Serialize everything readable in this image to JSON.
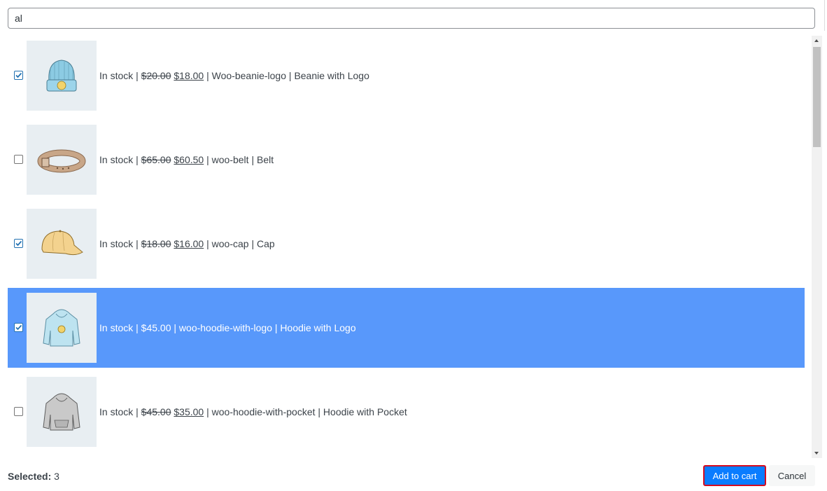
{
  "search": {
    "value": "al"
  },
  "products": [
    {
      "stock": "In stock",
      "regular_price": "$20.00",
      "sale_price": "$18.00",
      "price": "",
      "sku": "Woo-beanie-logo",
      "name": "Beanie with Logo",
      "checked": true,
      "highlighted": false,
      "image_icon": "beanie-image"
    },
    {
      "stock": "In stock",
      "regular_price": "$65.00",
      "sale_price": "$60.50",
      "price": "",
      "sku": "woo-belt",
      "name": "Belt",
      "checked": false,
      "highlighted": false,
      "image_icon": "belt-image"
    },
    {
      "stock": "In stock",
      "regular_price": "$18.00",
      "sale_price": "$16.00",
      "price": "",
      "sku": "woo-cap",
      "name": "Cap",
      "checked": true,
      "highlighted": false,
      "image_icon": "cap-image"
    },
    {
      "stock": "In stock",
      "regular_price": "",
      "sale_price": "",
      "price": "$45.00",
      "sku": "woo-hoodie-with-logo",
      "name": "Hoodie with Logo",
      "checked": true,
      "highlighted": true,
      "image_icon": "hoodie-logo-image"
    },
    {
      "stock": "In stock",
      "regular_price": "$45.00",
      "sale_price": "$35.00",
      "price": "",
      "sku": "woo-hoodie-with-pocket",
      "name": "Hoodie with Pocket",
      "checked": false,
      "highlighted": false,
      "image_icon": "hoodie-pocket-image"
    }
  ],
  "footer": {
    "selected_label": "Selected:",
    "selected_count": "3",
    "add_to_cart": "Add to cart",
    "cancel": "Cancel"
  },
  "colors": {
    "highlight": "#5898fb",
    "primary_button": "#0a7cff",
    "focus_border": "#d50b1f"
  }
}
